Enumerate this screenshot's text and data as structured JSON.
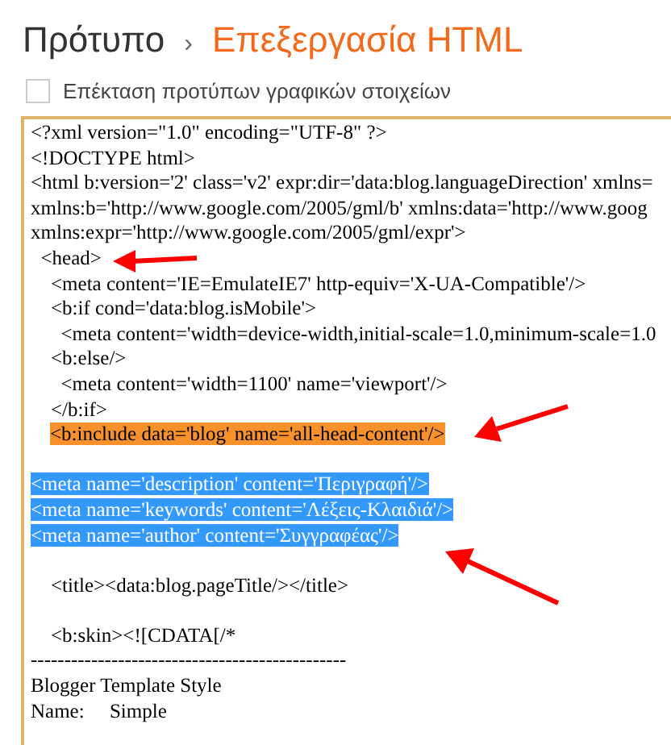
{
  "breadcrumb": {
    "parent": "Πρότυπο",
    "separator": "›",
    "current": "Επεξεργασία HTML"
  },
  "expand_widgets": {
    "label": "Επέκταση προτύπων γραφικών στοιχείων",
    "checked": false
  },
  "editor": {
    "lines": [
      {
        "kind": "plain",
        "text": "<?xml version=\"1.0\" encoding=\"UTF-8\" ?>"
      },
      {
        "kind": "plain",
        "text": "<!DOCTYPE html>"
      },
      {
        "kind": "plain",
        "text": "<html b:version='2' class='v2' expr:dir='data:blog.languageDirection' xmlns="
      },
      {
        "kind": "plain",
        "text": "xmlns:b='http://www.google.com/2005/gml/b' xmlns:data='http://www.goog"
      },
      {
        "kind": "plain",
        "text": "xmlns:expr='http://www.google.com/2005/gml/expr'>"
      },
      {
        "kind": "plain",
        "text": "  <head>"
      },
      {
        "kind": "plain",
        "text": "    <meta content='IE=EmulateIE7' http-equiv='X-UA-Compatible'/>"
      },
      {
        "kind": "plain",
        "text": "    <b:if cond='data:blog.isMobile'>"
      },
      {
        "kind": "plain",
        "text": "      <meta content='width=device-width,initial-scale=1.0,minimum-scale=1.0"
      },
      {
        "kind": "plain",
        "text": "    <b:else/>"
      },
      {
        "kind": "plain",
        "text": "      <meta content='width=1100' name='viewport'/>"
      },
      {
        "kind": "plain",
        "text": "    </b:if>"
      },
      {
        "kind": "highlight",
        "text": "<b:include data='blog' name='all-head-content'/>"
      },
      {
        "kind": "blank"
      },
      {
        "kind": "selection",
        "text": "<meta name='description' content='Περιγραφή'/>"
      },
      {
        "kind": "selection",
        "text": "<meta name='keywords' content='Λέξεις-Κλαιδιά'/>"
      },
      {
        "kind": "selection",
        "text": "<meta name='author' content='Συγγραφέας'/>"
      },
      {
        "kind": "blank"
      },
      {
        "kind": "plain",
        "text": "    <title><data:blog.pageTitle/></title>"
      },
      {
        "kind": "blank"
      },
      {
        "kind": "plain",
        "text": "    <b:skin><![CDATA[/*"
      },
      {
        "kind": "plain",
        "text": "-----------------------------------------------"
      },
      {
        "kind": "plain",
        "text": "Blogger Template Style"
      },
      {
        "kind": "plain",
        "text": "Name:     Simple"
      }
    ]
  }
}
